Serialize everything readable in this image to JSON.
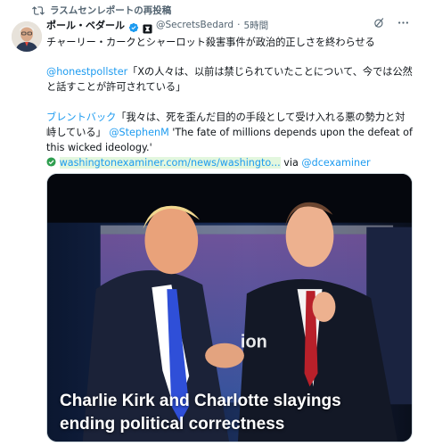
{
  "repost": {
    "label": "ラスムセンレポートの再投稿",
    "icon": "repost-icon"
  },
  "author": {
    "name": "ポール・ベダール",
    "handle": "@SecretsBedard",
    "separator": "·",
    "time": "5時間",
    "verified": true,
    "verified_color": "#1d9bf0"
  },
  "header_actions": {
    "grok_icon": "grok-icon",
    "more_icon": "more-icon"
  },
  "tweet": {
    "line1": "チャーリー・カークとシャーロット殺害事件が政治的正しさを終わらせる",
    "quote_mention": "@honestpollster",
    "quote_text": "「Xの人々は、以前は禁じられていたことについて、今では公然と話すことが許可されている」",
    "backlash_label": "ブレントバック",
    "backlash_text": "「我々は、死を歪んだ目的の手段として受け入れる悪の勢力と対峙している」",
    "stephen_mention": "@StephenM",
    "english_quote": " 'The fate of millions depends upon the defeat of this wicked ideology.'",
    "url": "washingtonexaminer.com/news/washingto...",
    "via": " via ",
    "via_mention": "@dcexaminer",
    "link_color": "#1d9bf0"
  },
  "media": {
    "caption_line1": "Charlie Kirk and Charlotte slayings",
    "caption_line2": "ending political correctness",
    "backdrop_fragment": "ion"
  }
}
